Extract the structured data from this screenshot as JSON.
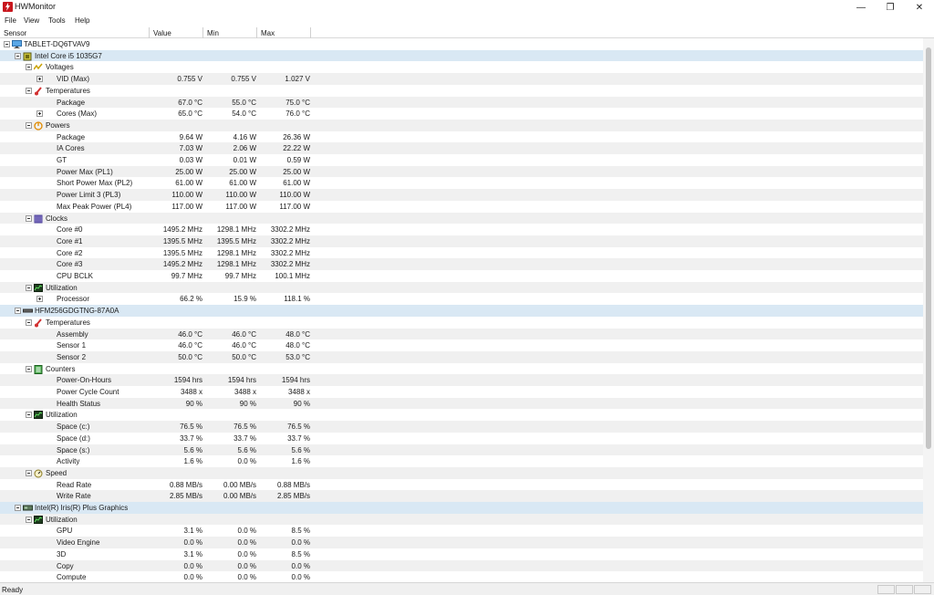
{
  "window": {
    "title": "HWMonitor",
    "minimize": "—",
    "maximize": "❐",
    "close": "✕"
  },
  "menu": [
    "File",
    "View",
    "Tools",
    "Help"
  ],
  "columns": [
    "Sensor",
    "Value",
    "Min",
    "Max"
  ],
  "rows": [
    {
      "level": 0,
      "kind": "dev",
      "toggle": "minus",
      "icon": "computer-icon",
      "label": "TABLET-DQ6TVAV9"
    },
    {
      "level": 1,
      "kind": "dev",
      "toggle": "minus",
      "icon": "cpu-icon",
      "label": "Intel Core i5 1035G7",
      "highlight": true
    },
    {
      "level": 2,
      "toggle": "minus",
      "icon": "voltage-icon",
      "label": "Voltages"
    },
    {
      "level": 3,
      "toggle": "plus",
      "label": "VID (Max)",
      "value": "0.755 V",
      "min": "0.755 V",
      "max": "1.027 V"
    },
    {
      "level": 2,
      "toggle": "minus",
      "icon": "thermometer-icon",
      "label": "Temperatures"
    },
    {
      "level": 3,
      "label": "Package",
      "value": "67.0 °C",
      "min": "55.0 °C",
      "max": "75.0 °C"
    },
    {
      "level": 3,
      "toggle": "plus",
      "label": "Cores (Max)",
      "value": "65.0 °C",
      "min": "54.0 °C",
      "max": "76.0 °C"
    },
    {
      "level": 2,
      "toggle": "minus",
      "icon": "power-icon",
      "label": "Powers"
    },
    {
      "level": 3,
      "label": "Package",
      "value": "9.64 W",
      "min": "4.16 W",
      "max": "26.36 W"
    },
    {
      "level": 3,
      "label": "IA Cores",
      "value": "7.03 W",
      "min": "2.06 W",
      "max": "22.22 W"
    },
    {
      "level": 3,
      "label": "GT",
      "value": "0.03 W",
      "min": "0.01 W",
      "max": "0.59 W"
    },
    {
      "level": 3,
      "label": "Power Max (PL1)",
      "value": "25.00 W",
      "min": "25.00 W",
      "max": "25.00 W"
    },
    {
      "level": 3,
      "label": "Short Power Max (PL2)",
      "value": "61.00 W",
      "min": "61.00 W",
      "max": "61.00 W"
    },
    {
      "level": 3,
      "label": "Power Limit 3 (PL3)",
      "value": "110.00 W",
      "min": "110.00 W",
      "max": "110.00 W"
    },
    {
      "level": 3,
      "label": "Max Peak Power (PL4)",
      "value": "117.00 W",
      "min": "117.00 W",
      "max": "117.00 W"
    },
    {
      "level": 2,
      "toggle": "minus",
      "icon": "clock-icon",
      "label": "Clocks"
    },
    {
      "level": 3,
      "label": "Core #0",
      "value": "1495.2 MHz",
      "min": "1298.1 MHz",
      "max": "3302.2 MHz"
    },
    {
      "level": 3,
      "label": "Core #1",
      "value": "1395.5 MHz",
      "min": "1395.5 MHz",
      "max": "3302.2 MHz"
    },
    {
      "level": 3,
      "label": "Core #2",
      "value": "1395.5 MHz",
      "min": "1298.1 MHz",
      "max": "3302.2 MHz"
    },
    {
      "level": 3,
      "label": "Core #3",
      "value": "1495.2 MHz",
      "min": "1298.1 MHz",
      "max": "3302.2 MHz"
    },
    {
      "level": 3,
      "label": "CPU BCLK",
      "value": "99.7 MHz",
      "min": "99.7 MHz",
      "max": "100.1 MHz"
    },
    {
      "level": 2,
      "toggle": "minus",
      "icon": "utilization-icon",
      "label": "Utilization"
    },
    {
      "level": 3,
      "toggle": "plus",
      "label": "Processor",
      "value": "66.2 %",
      "min": "15.9 %",
      "max": "118.1 %"
    },
    {
      "level": 1,
      "kind": "dev",
      "toggle": "minus",
      "icon": "drive-icon",
      "label": "HFM256GDGTNG-87A0A",
      "highlight": true
    },
    {
      "level": 2,
      "toggle": "minus",
      "icon": "thermometer-icon",
      "label": "Temperatures"
    },
    {
      "level": 3,
      "label": "Assembly",
      "value": "46.0 °C",
      "min": "46.0 °C",
      "max": "48.0 °C"
    },
    {
      "level": 3,
      "label": "Sensor 1",
      "value": "46.0 °C",
      "min": "46.0 °C",
      "max": "48.0 °C"
    },
    {
      "level": 3,
      "label": "Sensor 2",
      "value": "50.0 °C",
      "min": "50.0 °C",
      "max": "53.0 °C"
    },
    {
      "level": 2,
      "toggle": "minus",
      "icon": "counter-icon",
      "label": "Counters"
    },
    {
      "level": 3,
      "label": "Power-On-Hours",
      "value": "1594 hrs",
      "min": "1594 hrs",
      "max": "1594 hrs"
    },
    {
      "level": 3,
      "label": "Power Cycle Count",
      "value": "3488 x",
      "min": "3488 x",
      "max": "3488 x"
    },
    {
      "level": 3,
      "label": "Health Status",
      "value": "90 %",
      "min": "90 %",
      "max": "90 %"
    },
    {
      "level": 2,
      "toggle": "minus",
      "icon": "utilization-icon",
      "label": "Utilization"
    },
    {
      "level": 3,
      "label": "Space (c:)",
      "value": "76.5 %",
      "min": "76.5 %",
      "max": "76.5 %"
    },
    {
      "level": 3,
      "label": "Space (d:)",
      "value": "33.7 %",
      "min": "33.7 %",
      "max": "33.7 %"
    },
    {
      "level": 3,
      "label": "Space (s:)",
      "value": "5.6 %",
      "min": "5.6 %",
      "max": "5.6 %"
    },
    {
      "level": 3,
      "label": "Activity",
      "value": "1.6 %",
      "min": "0.0 %",
      "max": "1.6 %"
    },
    {
      "level": 2,
      "toggle": "minus",
      "icon": "speed-icon",
      "label": "Speed"
    },
    {
      "level": 3,
      "label": "Read Rate",
      "value": "0.88 MB/s",
      "min": "0.00 MB/s",
      "max": "0.88 MB/s"
    },
    {
      "level": 3,
      "label": "Write Rate",
      "value": "2.85 MB/s",
      "min": "0.00 MB/s",
      "max": "2.85 MB/s"
    },
    {
      "level": 1,
      "kind": "dev",
      "toggle": "minus",
      "icon": "gpu-icon",
      "label": "Intel(R) Iris(R) Plus Graphics",
      "highlight": true
    },
    {
      "level": 2,
      "toggle": "minus",
      "icon": "utilization-icon",
      "label": "Utilization"
    },
    {
      "level": 3,
      "label": "GPU",
      "value": "3.1 %",
      "min": "0.0 %",
      "max": "8.5 %"
    },
    {
      "level": 3,
      "label": "Video Engine",
      "value": "0.0 %",
      "min": "0.0 %",
      "max": "0.0 %"
    },
    {
      "level": 3,
      "label": "3D",
      "value": "3.1 %",
      "min": "0.0 %",
      "max": "8.5 %"
    },
    {
      "level": 3,
      "label": "Copy",
      "value": "0.0 %",
      "min": "0.0 %",
      "max": "0.0 %"
    },
    {
      "level": 3,
      "label": "Compute",
      "value": "0.0 %",
      "min": "0.0 %",
      "max": "0.0 %"
    }
  ],
  "status": {
    "text": "Ready"
  },
  "colors": {
    "device_highlight": "#d9e8f4",
    "alt_row": "#f0f0f0",
    "app_icon": "#c8171e"
  }
}
